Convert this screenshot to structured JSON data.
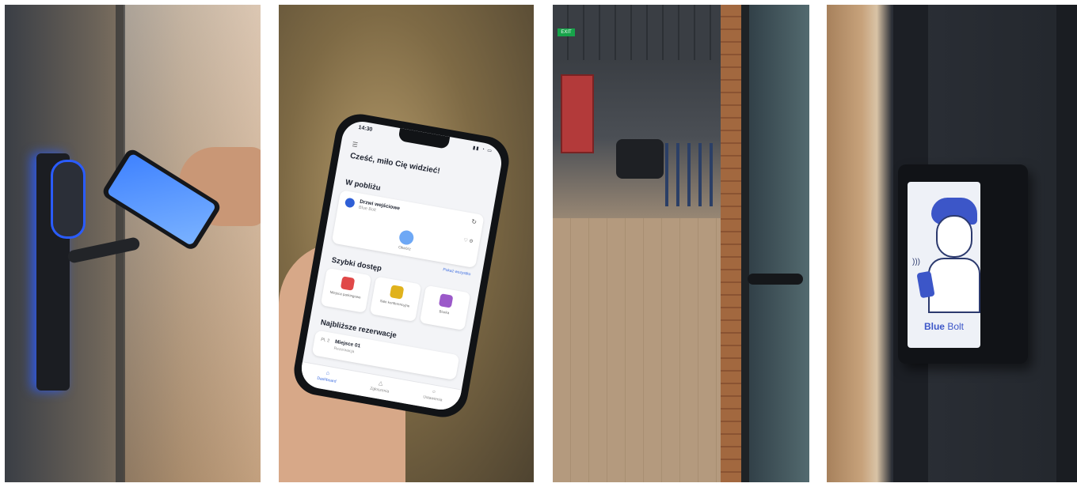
{
  "phone_app": {
    "status_time": "14:30",
    "greeting": "Cześć, miło Cię widzieć!",
    "nearby_title": "W pobliżu",
    "door_name": "Drzwi wejściowe",
    "door_sub": "Blue Bolt",
    "open_label": "Otwórz",
    "more_link": "Pokaż wszystko",
    "quick_title": "Szybki dostęp",
    "quick_tiles": [
      {
        "label": "Miejsca parkingowe",
        "color": "#e04848"
      },
      {
        "label": "Sale konferencyjne",
        "color": "#e0b21c"
      },
      {
        "label": "Biurka",
        "color": "#9b59c9"
      }
    ],
    "reservations_title": "Najbliższe rezerwacje",
    "reservation": {
      "num": "Pl. 2",
      "name": "Miejsce 01",
      "sub": "Rezerwacja"
    },
    "tabs": [
      {
        "label": "Dashboard",
        "icon": "⌂"
      },
      {
        "label": "Zgłoszenia",
        "icon": "△"
      },
      {
        "label": "Ustawienia",
        "icon": "○"
      }
    ]
  },
  "office": {
    "exit_sign": "EXIT"
  },
  "reader": {
    "brand_bold": "Blue",
    "brand_light": "Bolt"
  }
}
